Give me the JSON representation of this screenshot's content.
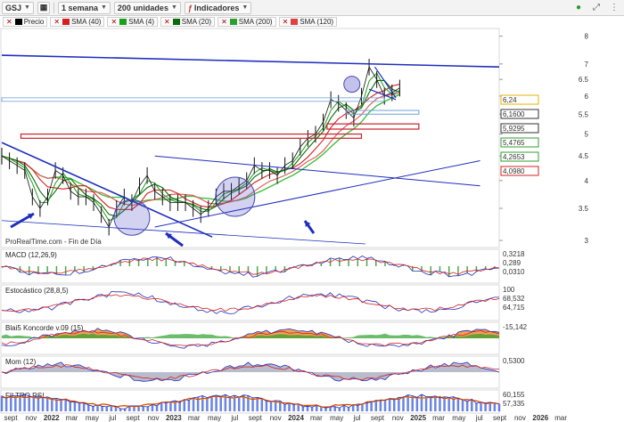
{
  "toolbar": {
    "symbol": "GSJ",
    "period": "1 semana",
    "units": "200 unidades",
    "indicators": "Indicadores"
  },
  "legend": [
    {
      "label": "Precio",
      "color": "#000000"
    },
    {
      "label": "SMA (40)",
      "color": "#d62020"
    },
    {
      "label": "SMA (4)",
      "color": "#1a9f1a"
    },
    {
      "label": "SMA (20)",
      "color": "#0b6b0b"
    },
    {
      "label": "SMA (200)",
      "color": "#2ca02c"
    },
    {
      "label": "SMA (120)",
      "color": "#e04040"
    }
  ],
  "watermark": "ProRealTime.com - Fin de Día",
  "colors": {
    "price": "#111111",
    "sma4": "#1a9f1a",
    "sma20": "#0b6b0b",
    "sma40": "#d62020",
    "sma120": "#e06060",
    "sma200": "#40c040",
    "trend": "#1f2ebd",
    "box": "#c8202a",
    "accent_box": "#6fa0d8"
  },
  "chart_data": [
    {
      "type": "line",
      "title": "Precio",
      "x_ticks": [
        "sept",
        "nov",
        "2022",
        "mar",
        "may",
        "jul",
        "sept",
        "nov",
        "2023",
        "mar",
        "may",
        "jul",
        "sept",
        "nov",
        "2024",
        "mar",
        "may",
        "jul",
        "sept",
        "nov",
        "2025",
        "mar",
        "may",
        "jul",
        "sept",
        "nov",
        "2026",
        "mar"
      ],
      "y_ticks": [
        3,
        3.5,
        4,
        4.5,
        5,
        5.5,
        6,
        6.5,
        7,
        8
      ],
      "ylim": [
        2.9,
        8.3
      ],
      "scale": "log",
      "price_labels": [
        {
          "value": "6,24",
          "color": "#e8b000"
        },
        {
          "value": "6,1600",
          "color": "#333333"
        },
        {
          "value": "5,9295",
          "color": "#333333"
        },
        {
          "value": "5,4765",
          "color": "#2ca02c"
        },
        {
          "value": "4,2653",
          "color": "#2ca02c"
        },
        {
          "value": "4,0980",
          "color": "#d62020"
        }
      ],
      "series": [
        {
          "name": "Precio",
          "x": [
            0,
            4,
            8,
            12,
            16,
            20,
            24,
            28,
            32,
            36,
            40,
            44,
            48,
            52,
            56,
            60,
            64,
            68,
            72,
            76,
            80,
            84,
            88,
            92,
            96,
            100,
            104,
            108,
            112,
            116,
            120,
            124,
            128,
            132,
            136,
            140,
            144,
            148,
            152,
            156,
            160,
            164,
            168,
            172,
            176,
            180,
            184,
            188,
            192,
            196,
            200,
            204,
            208
          ],
          "values": [
            4.5,
            4.4,
            4.3,
            4.2,
            3.7,
            3.5,
            3.7,
            4.2,
            4.1,
            3.8,
            3.7,
            3.7,
            3.6,
            3.4,
            3.2,
            3.5,
            3.7,
            3.6,
            3.9,
            4.1,
            3.8,
            3.7,
            3.6,
            3.6,
            3.6,
            3.5,
            3.4,
            3.5,
            3.7,
            3.8,
            3.8,
            3.9,
            4.0,
            4.3,
            4.2,
            4.2,
            4.1,
            4.3,
            4.4,
            4.7,
            4.9,
            5.0,
            5.3,
            5.9,
            5.8,
            5.6,
            5.4,
            6.0,
            6.9,
            6.5,
            6.0,
            6.1,
            6.24
          ]
        }
      ]
    },
    {
      "type": "line",
      "title": "MACD (12,26,9)",
      "right_labels": [
        "0,3218",
        "0,289",
        "0,0310"
      ]
    },
    {
      "type": "line",
      "title": "Estocástico (28,8,5)",
      "right_labels": [
        "100",
        "68,532",
        "64,715"
      ]
    },
    {
      "type": "area",
      "title": "Blai5 Koncorde v.09 (15)",
      "right_labels": [
        "-15,142"
      ]
    },
    {
      "type": "line",
      "title": "Mom (12)",
      "right_labels": [
        "0,5300"
      ]
    },
    {
      "type": "area",
      "title": "FILTRO RSI",
      "right_labels": [
        "60,155",
        "57,335"
      ]
    }
  ]
}
